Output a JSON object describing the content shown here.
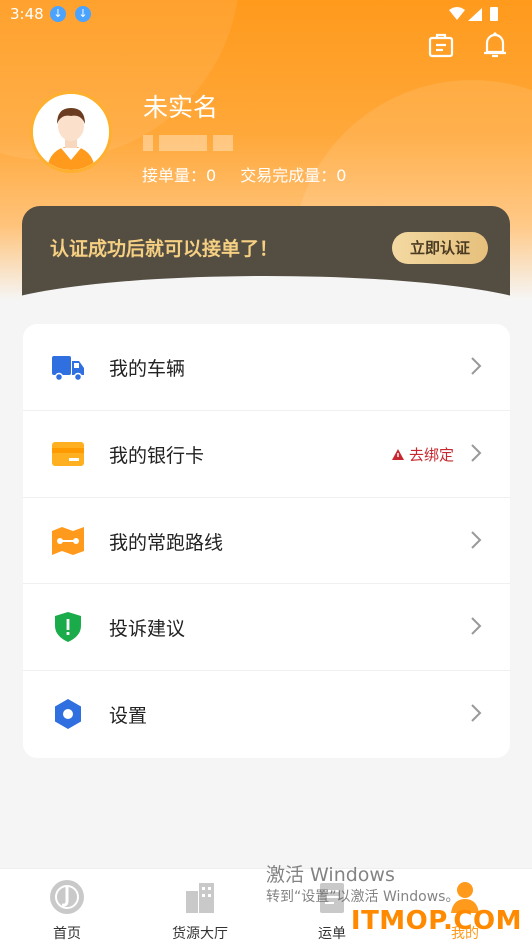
{
  "status_bar": {
    "time": "3:48"
  },
  "profile": {
    "name": "未实名",
    "orders_label": "接单量：",
    "orders_value": "0",
    "completed_label": "交易完成量：",
    "completed_value": "0"
  },
  "banner": {
    "message": "认证成功后就可以接单了！",
    "button": "立即认证"
  },
  "menu": {
    "items": [
      {
        "label": "我的车辆",
        "icon": "truck-icon"
      },
      {
        "label": "我的银行卡",
        "icon": "bank-card-icon",
        "tag": "去绑定"
      },
      {
        "label": "我的常跑路线",
        "icon": "route-map-icon"
      },
      {
        "label": "投诉建议",
        "icon": "shield-exclamation-icon"
      },
      {
        "label": "设置",
        "icon": "settings-hexagon-icon"
      }
    ]
  },
  "tabbar": {
    "tabs": [
      {
        "label": "首页"
      },
      {
        "label": "货源大厅"
      },
      {
        "label": "运单"
      },
      {
        "label": "我的"
      }
    ]
  },
  "watermark": {
    "line1": "激活 Windows",
    "line2": "转到“设置”以激活 Windows。"
  },
  "site_brand": "ITMOP.COM",
  "colors": {
    "primary": "#ff9a1c",
    "banner_bg": "#544d42",
    "banner_text": "#f5cf82",
    "warning": "#c7282f"
  }
}
